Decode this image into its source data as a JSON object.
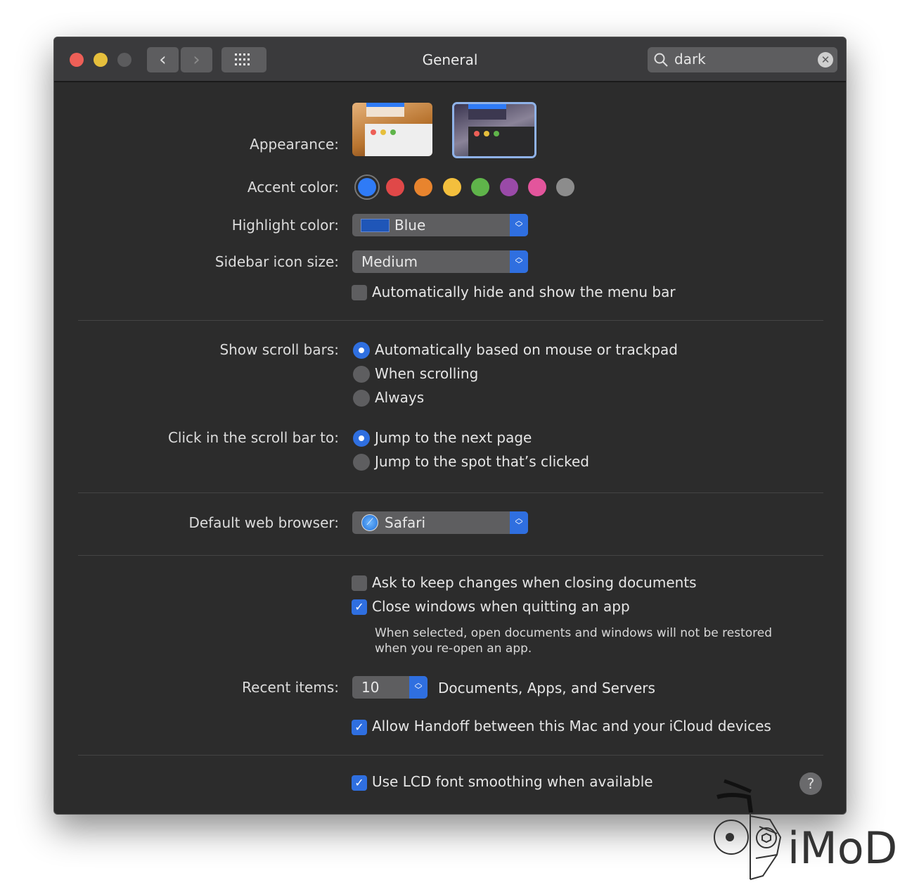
{
  "window": {
    "title": "General",
    "search_value": "dark"
  },
  "appearance": {
    "label": "Appearance:",
    "options": [
      "Light",
      "Dark"
    ],
    "selected": "Dark"
  },
  "accent": {
    "label": "Accent color:",
    "colors": [
      "#2f7bf6",
      "#e04848",
      "#e8842e",
      "#f3bf3d",
      "#5fb44a",
      "#9a4aa8",
      "#e3559c",
      "#8c8c8c"
    ],
    "selected": 0
  },
  "highlight": {
    "label": "Highlight color:",
    "value": "Blue",
    "swatch": "#1f56b8"
  },
  "sidebar": {
    "label": "Sidebar icon size:",
    "value": "Medium"
  },
  "menubar": {
    "label": "Automatically hide and show the menu bar",
    "checked": false
  },
  "scrollbars": {
    "label": "Show scroll bars:",
    "options": [
      "Automatically based on mouse or trackpad",
      "When scrolling",
      "Always"
    ],
    "selected": 0
  },
  "click": {
    "label": "Click in the scroll bar to:",
    "options": [
      "Jump to the next page",
      "Jump to the spot that’s clicked"
    ],
    "selected": 0
  },
  "browser": {
    "label": "Default web browser:",
    "value": "Safari"
  },
  "ask_keep": {
    "label": "Ask to keep changes when closing documents",
    "checked": false
  },
  "close_windows": {
    "label": "Close windows when quitting an app",
    "checked": true,
    "note1": "When selected, open documents and windows will not be restored",
    "note2": "when you re-open an app."
  },
  "recent": {
    "label": "Recent items:",
    "value": "10",
    "suffix": "Documents, Apps, and Servers"
  },
  "handoff": {
    "label": "Allow Handoff between this Mac and your iCloud devices",
    "checked": true
  },
  "lcd": {
    "label": "Use LCD font smoothing when available",
    "checked": true
  },
  "help": "?",
  "watermark": "iMoD"
}
